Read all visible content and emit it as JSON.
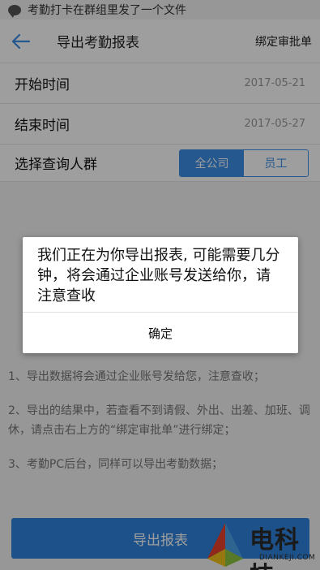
{
  "status_bar": {
    "notification_text": "考勤打卡在群组里发了一个文件",
    "notification_icon": "chat-bubble-icon"
  },
  "navbar": {
    "title": "导出考勤报表",
    "right_link": "绑定审批单",
    "back_icon": "arrow-left-icon"
  },
  "form": {
    "start_label": "开始时间",
    "start_value": "2017-05-21",
    "end_label": "结束时间",
    "end_value": "2017-05-27",
    "group_label": "选择查询人群",
    "segment": {
      "option_company": "全公司",
      "option_staff": "员工",
      "selected": "全公司"
    }
  },
  "notes": [
    "1、导出数据将会通过企业账号发给您，注意查收；",
    "2、导出的结果中，若查看不到请假、外出、出差、加班、调休，请点击右上方的“绑定审批单”进行绑定；",
    "3、考勤PC后台，同样可以导出考勤数据；"
  ],
  "export_button": "导出报表",
  "dialog": {
    "message": "我们正在为你导出报表, 可能需要几分钟，将会通过企业账号发送给你，请注意查收",
    "confirm": "确定"
  },
  "watermark": {
    "brand": "电科技",
    "domain": "DIANKEJI.COM"
  },
  "colors": {
    "accent": "#3a8ee6",
    "button": "#2f83df"
  }
}
